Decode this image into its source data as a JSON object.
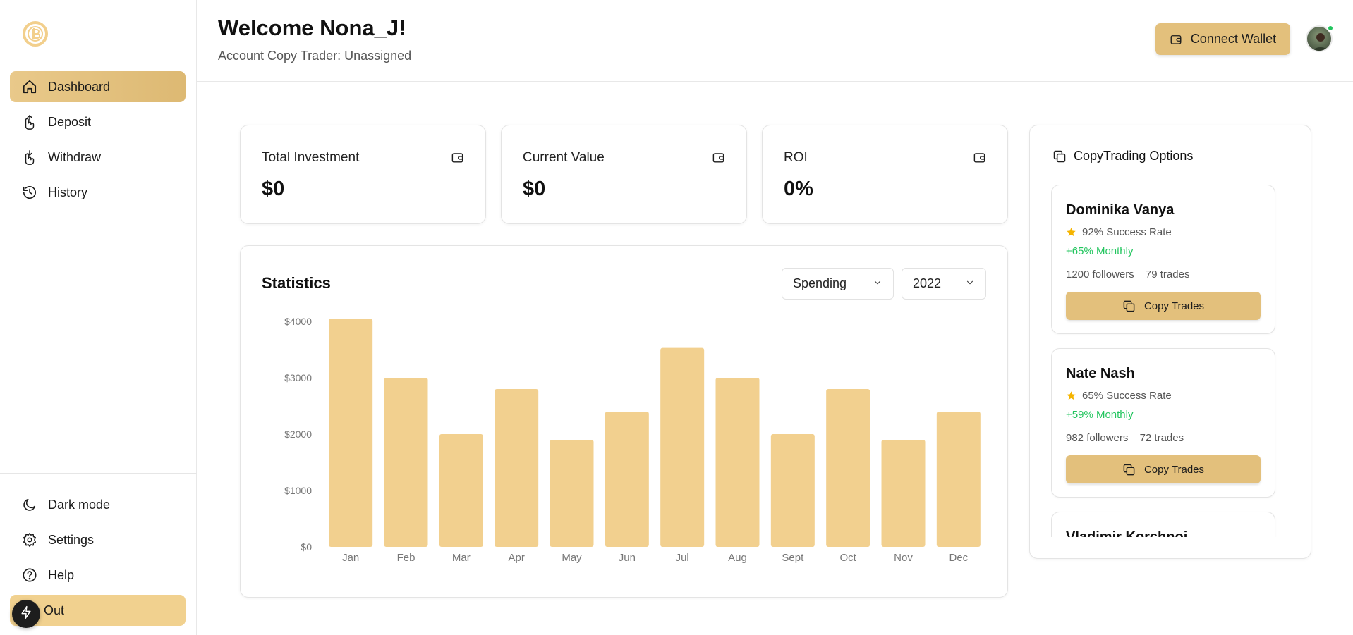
{
  "sidebar": {
    "logo_icon": "coin-logo-icon",
    "items": [
      {
        "label": "Dashboard",
        "icon": "home-icon",
        "active": true
      },
      {
        "label": "Deposit",
        "icon": "deposit-icon"
      },
      {
        "label": "Withdraw",
        "icon": "withdraw-icon"
      },
      {
        "label": "History",
        "icon": "history-icon"
      }
    ],
    "bottom_items": [
      {
        "label": "Dark mode",
        "icon": "moon-icon"
      },
      {
        "label": "Settings",
        "icon": "gear-icon"
      },
      {
        "label": "Help",
        "icon": "help-icon"
      },
      {
        "label": "Out",
        "icon": "logout-icon"
      }
    ]
  },
  "header": {
    "welcome": "Welcome Nona_J!",
    "subtitle": "Account Copy Trader: Unassigned",
    "connect_wallet": "Connect Wallet"
  },
  "stats_cards": [
    {
      "label": "Total Investment",
      "value": "$0",
      "icon": "wallet-icon"
    },
    {
      "label": "Current Value",
      "value": "$0",
      "icon": "wallet-icon"
    },
    {
      "label": "ROI",
      "value": "0%",
      "icon": "wallet-icon"
    }
  ],
  "statistics": {
    "title": "Statistics",
    "type_select": "Spending",
    "year_select": "2022"
  },
  "chart_data": {
    "type": "bar",
    "categories": [
      "Jan",
      "Feb",
      "Mar",
      "Apr",
      "May",
      "Jun",
      "Jul",
      "Aug",
      "Sept",
      "Oct",
      "Nov",
      "Dec"
    ],
    "values": [
      4050,
      3000,
      2000,
      2800,
      1900,
      2400,
      3530,
      3000,
      2000,
      2800,
      1900,
      2400
    ],
    "y_ticks": [
      "$0",
      "$1000",
      "$2000",
      "$3000",
      "$4000"
    ],
    "ylim": [
      0,
      4000
    ],
    "grid": false,
    "bar_color": "#f2d08f"
  },
  "copy_trading": {
    "title": "CopyTrading Options",
    "traders": [
      {
        "name": "Dominika Vanya",
        "success": "92% Success Rate",
        "monthly": "+65% Monthly",
        "followers": "1200 followers",
        "trades": "79 trades",
        "button": "Copy Trades"
      },
      {
        "name": "Nate Nash",
        "success": "65% Success Rate",
        "monthly": "+59% Monthly",
        "followers": "982 followers",
        "trades": "72 trades",
        "button": "Copy Trades"
      },
      {
        "name": "Vladimir Korchnoi",
        "success": "",
        "monthly": "",
        "followers": "",
        "trades": "",
        "button": ""
      }
    ]
  },
  "colors": {
    "accent": "#e3c07c",
    "bar": "#f2d08f",
    "positive": "#22c55e"
  }
}
